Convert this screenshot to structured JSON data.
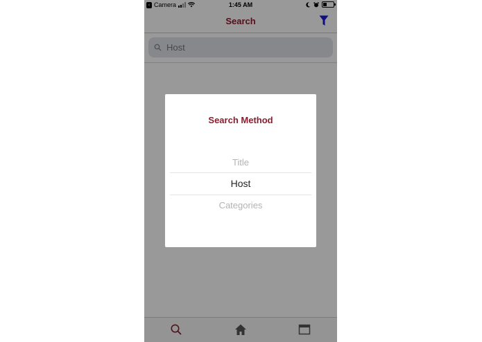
{
  "status_bar": {
    "back_app": "Camera",
    "time": "1:45 AM"
  },
  "nav": {
    "title": "Search",
    "filter_icon": "filter-icon",
    "title_color": "#8c1c2c",
    "filter_color": "#1a1ad6"
  },
  "search": {
    "value": "Host",
    "icon": "search-icon"
  },
  "modal": {
    "title": "Search Method",
    "options": [
      "Title",
      "Host",
      "Categories"
    ],
    "selected": "Host"
  },
  "tab_bar": {
    "tabs": [
      {
        "icon": "search-icon",
        "active": true
      },
      {
        "icon": "home-icon",
        "active": false
      },
      {
        "icon": "calendar-icon",
        "active": false
      }
    ],
    "active_color": "#8c1c2c"
  }
}
